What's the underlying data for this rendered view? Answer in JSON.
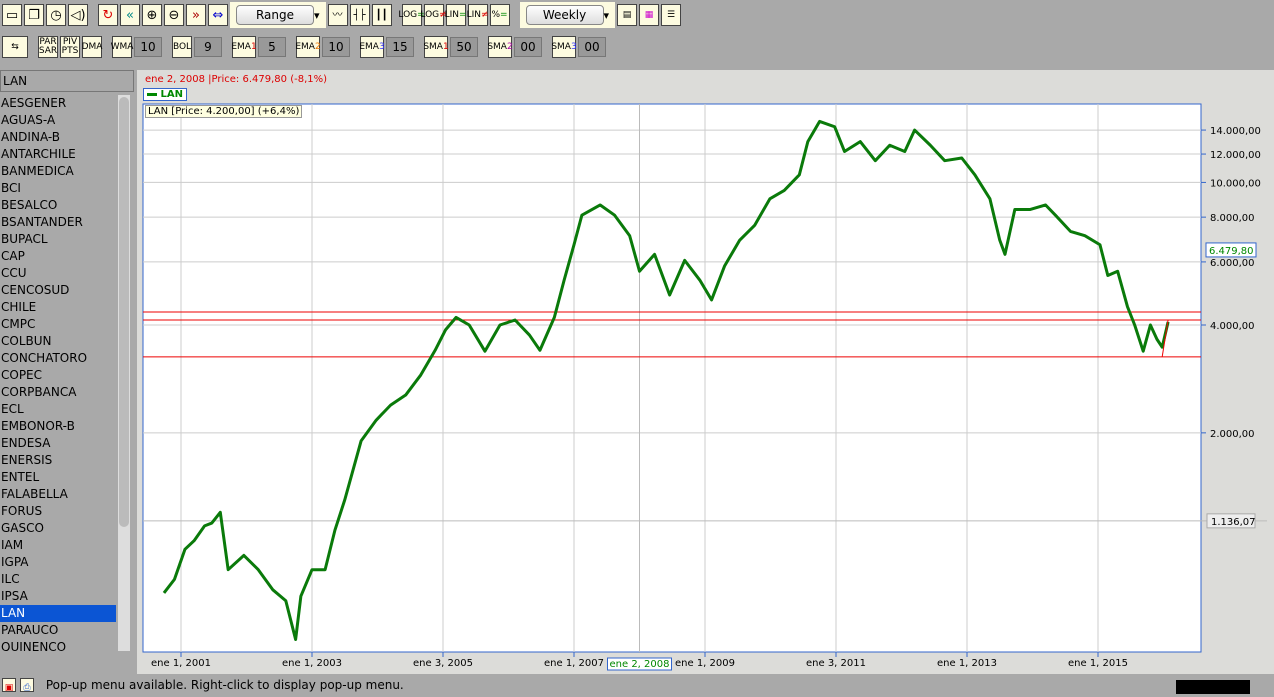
{
  "toolbar": {
    "range_label": "Range",
    "period_label": "Weekly",
    "icons": [
      "new-window-icon",
      "copy-window-icon",
      "timer-icon",
      "sound-icon",
      "refresh-icon",
      "rewind-icon",
      "zoom-in-icon",
      "zoom-out-icon",
      "fast-forward-icon",
      "fit-icon"
    ],
    "chart_types": [
      "line-chart-icon",
      "bar-chart-icon",
      "candlestick-icon"
    ],
    "scales": [
      {
        "top": "LOG",
        "bottom": "="
      },
      {
        "top": "LOG",
        "bottom": "≠"
      },
      {
        "top": "LIN",
        "bottom": "="
      },
      {
        "top": "LIN",
        "bottom": "≠"
      },
      {
        "top": "%",
        "bottom": "="
      }
    ]
  },
  "indicators": {
    "par_sar": "PAR SAR",
    "piv_pts": "PIV PTS",
    "dma": "DMA",
    "wma": "WMA",
    "wma_val": "10",
    "bol": "BOL",
    "bol_val": "9",
    "ema1": "EMA",
    "ema1_n": "1",
    "ema1_val": "5",
    "ema2": "EMA",
    "ema2_n": "2",
    "ema2_val": "10",
    "ema3": "EMA",
    "ema3_n": "3",
    "ema3_val": "15",
    "sma1": "SMA",
    "sma1_n": "1",
    "sma1_val": "50",
    "sma2": "SMA",
    "sma2_n": "2",
    "sma2_val": "00",
    "sma3": "SMA",
    "sma3_n": "3",
    "sma3_val": "00"
  },
  "sidebar": {
    "selected": "LAN",
    "items": [
      "AESGENER",
      "AGUAS-A",
      "ANDINA-B",
      "ANTARCHILE",
      "BANMEDICA",
      "BCI",
      "BESALCO",
      "BSANTANDER",
      "BUPACL",
      "CAP",
      "CCU",
      "CENCOSUD",
      "CHILE",
      "CMPC",
      "COLBUN",
      "CONCHATORO",
      "COPEC",
      "CORPBANCA",
      "ECL",
      "EMBONOR-B",
      "ENDESA",
      "ENERSIS",
      "ENTEL",
      "FALABELLA",
      "FORUS",
      "GASCO",
      "IAM",
      "IGPA",
      "ILC",
      "IPSA",
      "LAN",
      "PARAUCO",
      "QUINENCO"
    ]
  },
  "chart_header": {
    "cursor_info": "ene 2, 2008 |Price: 6.479,80 (-8,1%)",
    "legend": "LAN",
    "last_info": "LAN [Price: 4.200,00] (+6,4%)"
  },
  "status": {
    "message": "Pop-up menu available. Right-click to display pop-up menu."
  },
  "chart_data": {
    "type": "line",
    "scale": "log",
    "series": [
      {
        "name": "LAN",
        "color": "#0a7a0a",
        "points": [
          [
            2000.74,
            715
          ],
          [
            2000.9,
            780
          ],
          [
            2001.06,
            946
          ],
          [
            2001.2,
            1000
          ],
          [
            2001.36,
            1100
          ],
          [
            2001.47,
            1120
          ],
          [
            2001.6,
            1200
          ],
          [
            2001.72,
            830
          ],
          [
            2001.96,
            910
          ],
          [
            2002.18,
            830
          ],
          [
            2002.4,
            730
          ],
          [
            2002.6,
            680
          ],
          [
            2002.75,
            530
          ],
          [
            2002.83,
            700
          ],
          [
            2003.0,
            830
          ],
          [
            2003.2,
            830
          ],
          [
            2003.35,
            1070
          ],
          [
            2003.5,
            1300
          ],
          [
            2003.75,
            1900
          ],
          [
            2003.98,
            2170
          ],
          [
            2004.2,
            2390
          ],
          [
            2004.43,
            2550
          ],
          [
            2004.66,
            2900
          ],
          [
            2004.88,
            3400
          ],
          [
            2005.04,
            3880
          ],
          [
            2005.2,
            4200
          ],
          [
            2005.4,
            4000
          ],
          [
            2005.64,
            3380
          ],
          [
            2005.87,
            4000
          ],
          [
            2006.1,
            4130
          ],
          [
            2006.32,
            3750
          ],
          [
            2006.48,
            3400
          ],
          [
            2006.7,
            4200
          ],
          [
            2006.85,
            5340
          ],
          [
            2007.0,
            6700
          ],
          [
            2007.12,
            8100
          ],
          [
            2007.4,
            8650
          ],
          [
            2007.62,
            8100
          ],
          [
            2007.85,
            7100
          ],
          [
            2008.0,
            5650
          ],
          [
            2008.23,
            6300
          ],
          [
            2008.46,
            4850
          ],
          [
            2008.69,
            6060
          ],
          [
            2008.92,
            5340
          ],
          [
            2009.1,
            4700
          ],
          [
            2009.3,
            5850
          ],
          [
            2009.53,
            6900
          ],
          [
            2009.76,
            7600
          ],
          [
            2009.99,
            9000
          ],
          [
            2010.21,
            9500
          ],
          [
            2010.44,
            10500
          ],
          [
            2010.57,
            13000
          ],
          [
            2010.75,
            14800
          ],
          [
            2010.98,
            14300
          ],
          [
            2011.13,
            12200
          ],
          [
            2011.37,
            13000
          ],
          [
            2011.6,
            11500
          ],
          [
            2011.82,
            12700
          ],
          [
            2012.05,
            12200
          ],
          [
            2012.2,
            14000
          ],
          [
            2012.44,
            12700
          ],
          [
            2012.66,
            11500
          ],
          [
            2012.92,
            11700
          ],
          [
            2013.12,
            10500
          ],
          [
            2013.35,
            9000
          ],
          [
            2013.5,
            6900
          ],
          [
            2013.58,
            6300
          ],
          [
            2013.73,
            8400
          ],
          [
            2013.96,
            8400
          ],
          [
            2014.2,
            8650
          ],
          [
            2014.35,
            8100
          ],
          [
            2014.58,
            7300
          ],
          [
            2014.8,
            7100
          ],
          [
            2015.03,
            6700
          ],
          [
            2015.15,
            5500
          ],
          [
            2015.3,
            5650
          ],
          [
            2015.45,
            4500
          ],
          [
            2015.56,
            4000
          ],
          [
            2015.69,
            3380
          ],
          [
            2015.8,
            4000
          ],
          [
            2015.9,
            3650
          ],
          [
            2015.98,
            3470
          ],
          [
            2016.07,
            4080
          ]
        ]
      }
    ],
    "hlines": [
      4350,
      4130,
      3260
    ],
    "y_ticks": [
      {
        "v": 14000,
        "label": "14.000,00"
      },
      {
        "v": 12000,
        "label": "12.000,00"
      },
      {
        "v": 10000,
        "label": "10.000,00"
      },
      {
        "v": 8000,
        "label": "8.000,00"
      },
      {
        "v": 6000,
        "label": "6.000,00"
      },
      {
        "v": 4000,
        "label": "4.000,00"
      },
      {
        "v": 2000,
        "label": "2.000,00"
      }
    ],
    "x_ticks": [
      {
        "v": 2001,
        "label": "ene 1, 2001"
      },
      {
        "v": 2003,
        "label": "ene 1, 2003"
      },
      {
        "v": 2005,
        "label": "ene 3, 2005"
      },
      {
        "v": 2007,
        "label": "ene 1, 2007"
      },
      {
        "v": 2009,
        "label": "ene 1, 2009"
      },
      {
        "v": 2011,
        "label": "ene 3, 2011"
      },
      {
        "v": 2013,
        "label": "ene 1, 2013"
      },
      {
        "v": 2015,
        "label": "ene 1, 2015"
      }
    ],
    "crosshair": {
      "x": 2008.0,
      "x_label": "ene 2, 2008",
      "y": 1136.07,
      "y_label": "1.136,07",
      "price_label": "6.479,80",
      "price": 6479.8
    }
  }
}
